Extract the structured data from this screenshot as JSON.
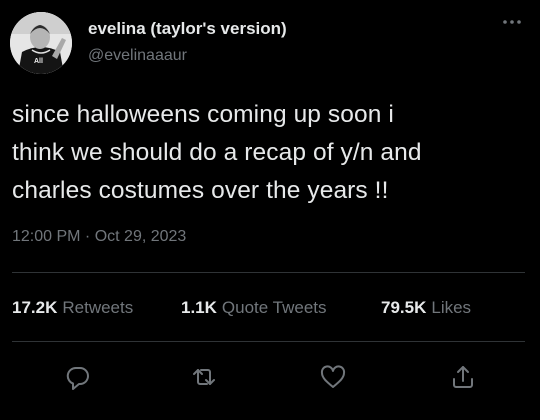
{
  "author": {
    "display_name": "evelina (taylor's version)",
    "handle": "@evelinaaaur",
    "avatar_icon": "profile-photo",
    "avatar_jersey_text": "All"
  },
  "tweet": {
    "text": "since halloweens coming up soon i\nthink we should do a recap of y/n and\ncharles costumes over the years !!",
    "timestamp": "12:00 PM · Oct 29, 2023"
  },
  "stats": {
    "retweets_count": "17.2K",
    "retweets_label": "Retweets",
    "quotes_count": "1.1K",
    "quotes_label": "Quote Tweets",
    "likes_count": "79.5K",
    "likes_label": "Likes"
  },
  "actions": [
    "reply-icon",
    "retweet-icon",
    "like-icon",
    "share-icon"
  ],
  "colors": {
    "background": "#000000",
    "primary_text": "#e7e9ea",
    "secondary_text": "#71767b",
    "divider": "#2f3336"
  }
}
